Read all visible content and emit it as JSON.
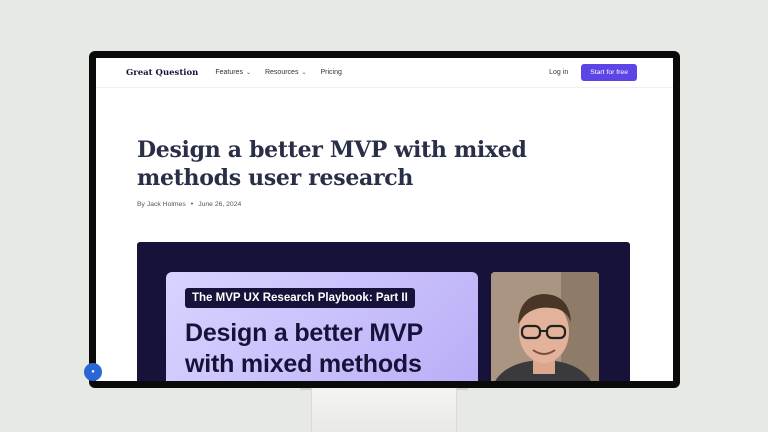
{
  "nav": {
    "logo": "Great Question",
    "features_label": "Features",
    "resources_label": "Resources",
    "pricing_label": "Pricing",
    "login_label": "Log in",
    "cta_label": "Start for free",
    "cta_color": "#5b45e6"
  },
  "article": {
    "title": "Design a better MVP with mixed methods user research",
    "author": "By Jack Holmes",
    "date": "June 26, 2024"
  },
  "hero": {
    "badge": "The MVP UX Research Playbook: Part II",
    "card_title": "Design a better MVP with mixed methods user research",
    "background_color": "#16123a",
    "photo_icon": "author-portrait"
  },
  "widget": {
    "icon": "accessibility-icon"
  }
}
